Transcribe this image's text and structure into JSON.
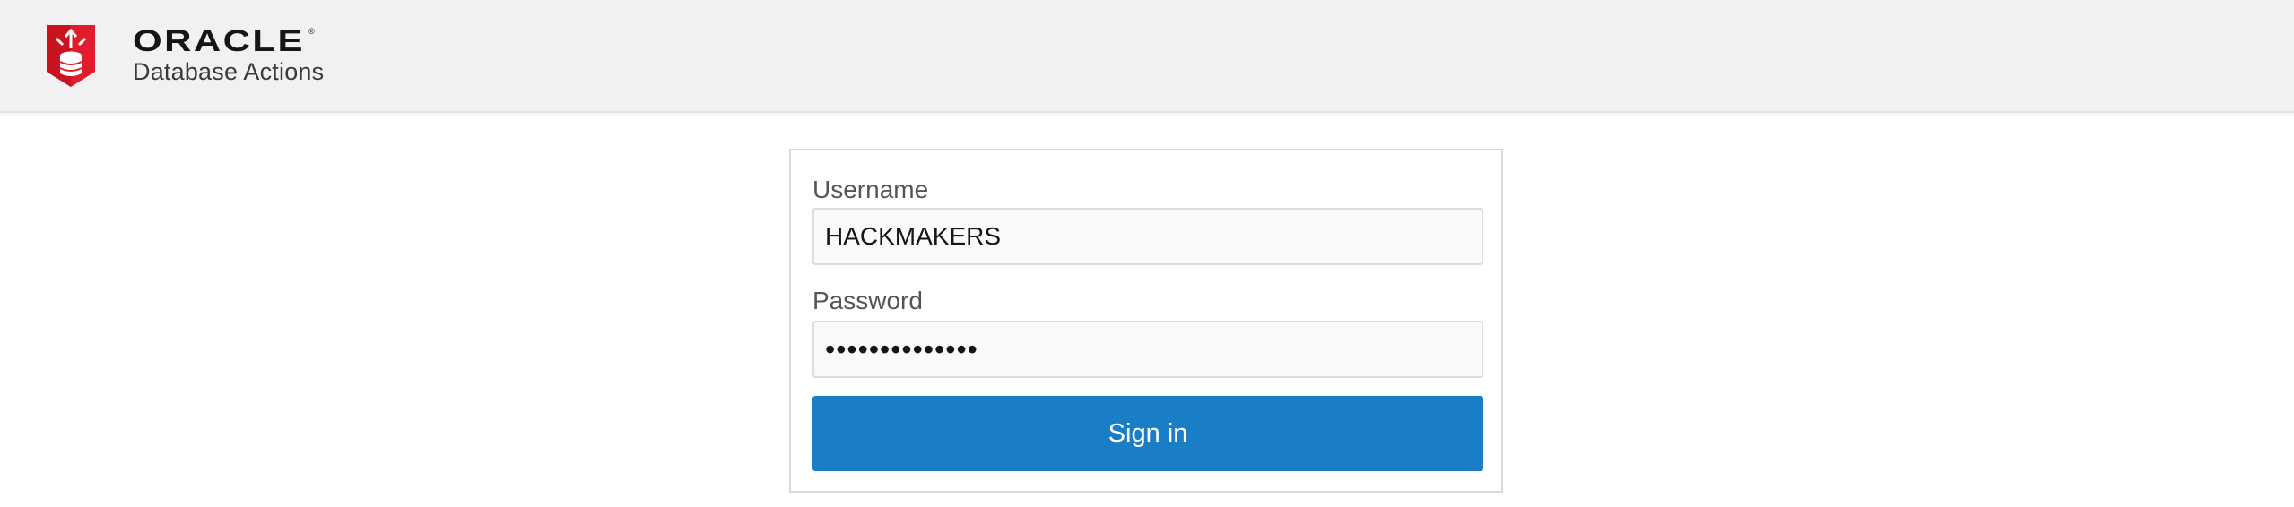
{
  "header": {
    "brand": "ORACLE",
    "product": "Database Actions",
    "logo_icon": "database-shield-icon",
    "brand_color": "#e11d2b"
  },
  "login": {
    "username_label": "Username",
    "username_value": "HACKMAKERS",
    "password_label": "Password",
    "password_value": "••••••••••••••",
    "signin_label": "Sign in",
    "button_color": "#1a7ec6"
  }
}
